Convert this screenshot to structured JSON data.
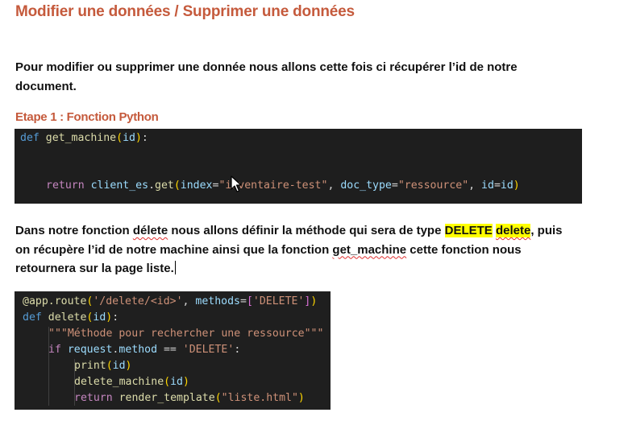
{
  "heading": "Modifier une données / Supprimer une données",
  "intro": {
    "line1": "Pour modifier ou supprimer une donnée nous allons cette fois ci récupérer l’id de notre",
    "line2": "document."
  },
  "step1_title": "Etape 1 : Fonction Python",
  "code1": {
    "line1_kw": "def",
    "line1_fn": "get_machine",
    "line1_param": "id",
    "line2_kw": "return",
    "line2_obj": "client_es",
    "line2_method": "get",
    "line2_arg1": "index",
    "line2_val1": "\"inventaire-test\"",
    "line2_arg2": "doc_type",
    "line2_val2": "\"ressource\"",
    "line2_arg3": "id",
    "line2_val3": "id"
  },
  "explanation": {
    "seg1": "Dans notre fonction ",
    "seg2": "délete",
    "seg3": "  nous allons définir la méthode qui sera de type ",
    "seg4": "DELETE",
    "seg5": " ",
    "seg6": "delete",
    "seg7": ", puis",
    "seg8": "on récupère l’id de notre machine ainsi que la fonction ",
    "seg9": "get_machine",
    "seg10": " cette fonction nous",
    "seg11": "retournera sur la page liste."
  },
  "code2": {
    "l1_dec": "@app.route",
    "l1_path": "'/delete/<id>'",
    "l1_methods": "methods",
    "l1_val": "'DELETE'",
    "l2_kw": "def",
    "l2_fn": "delete",
    "l2_param": "id",
    "l3_doc": "\"\"\"Méthode pour rechercher une ressource\"\"\"",
    "l4_kw": "if",
    "l4_obj": "request",
    "l4_attr": "method",
    "l4_val": "'DELETE'",
    "l5_fn": "print",
    "l5_arg": "id",
    "l6_fn": "delete_machine",
    "l6_arg": "id",
    "l7_kw": "return",
    "l7_fn": "render_template",
    "l7_arg": "\"liste.html\""
  }
}
